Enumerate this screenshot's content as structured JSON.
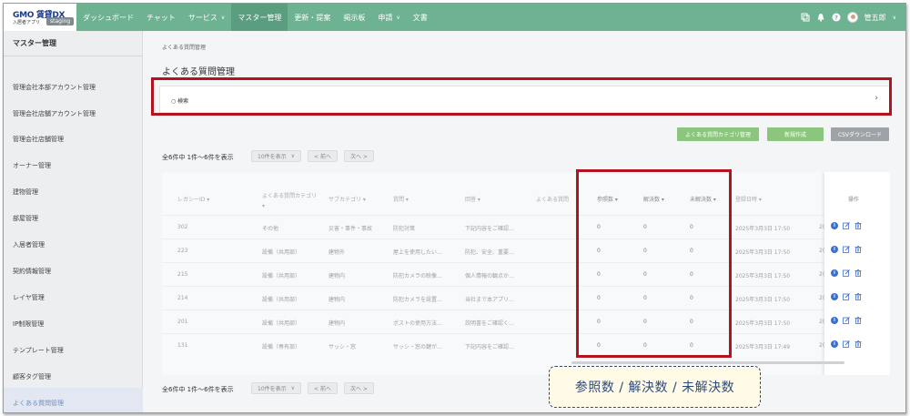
{
  "header": {
    "logo_main": "GMO 賃貸DX",
    "logo_sub": "入居者アプリ",
    "env_badge": "staging",
    "nav": [
      {
        "label": "ダッシュボード",
        "dropdown": false
      },
      {
        "label": "チャット",
        "dropdown": false
      },
      {
        "label": "サービス",
        "dropdown": true
      },
      {
        "label": "マスター管理",
        "dropdown": false,
        "active": true
      },
      {
        "label": "更新・提案",
        "dropdown": false
      },
      {
        "label": "掲示板",
        "dropdown": false
      },
      {
        "label": "申請",
        "dropdown": true
      },
      {
        "label": "文書",
        "dropdown": false
      }
    ],
    "user_name": "管五郎",
    "icons": [
      "window-icon",
      "bell-icon",
      "help-icon",
      "avatar"
    ]
  },
  "sidebar": {
    "title": "マスター管理",
    "items": [
      "管理会社本部アカウント管理",
      "管理会社店舗アカウント管理",
      "管理会社店舗管理",
      "オーナー管理",
      "建物管理",
      "部屋管理",
      "入居者管理",
      "契約情報管理",
      "レイヤ管理",
      "IP制限管理",
      "テンプレート管理",
      "顧客タグ管理",
      "よくある質問管理"
    ],
    "active_index": 12
  },
  "main": {
    "breadcrumb": "よくある質問管理",
    "title": "よくある質問管理",
    "search_label": "検索",
    "buttons": {
      "category": "よくある質問カテゴリ管理",
      "new": "新規作成",
      "csv": "CSVダウンロード"
    },
    "count_text": "全6件中 1件～6件を表示",
    "per_page": "10件を表示",
    "prev": "< 前へ",
    "next": "次へ >"
  },
  "table": {
    "columns": [
      "レガシーID",
      "よくある質問カテゴリ",
      "サブカテゴリ",
      "質問",
      "回答",
      "よくある質問",
      "参照数",
      "解決数",
      "未解決数",
      "登録日時",
      "操作"
    ],
    "rows": [
      {
        "id": "302",
        "cat": "その他",
        "sub": "災害・事件・事故",
        "q": "防犯対策",
        "a": "下記内容をご確認…",
        "ref": "0",
        "sol": "0",
        "unsol": "0",
        "date": "2025年3月3日 17:50",
        "extra": "2("
      },
      {
        "id": "223",
        "cat": "設備（共用部）",
        "sub": "建物外",
        "q": "屋上を使用したい…",
        "a": "防犯、安全、重要…",
        "ref": "0",
        "sol": "0",
        "unsol": "0",
        "date": "2025年3月3日 17:50",
        "extra": "2("
      },
      {
        "id": "215",
        "cat": "設備（共用部）",
        "sub": "建物内",
        "q": "防犯カメラの映像…",
        "a": "個人情報の観点か…",
        "ref": "0",
        "sol": "0",
        "unsol": "0",
        "date": "2025年3月3日 17:50",
        "extra": "2("
      },
      {
        "id": "214",
        "cat": "設備（共用部）",
        "sub": "建物内",
        "q": "防犯カメラを設置…",
        "a": "当社まで本アプリ…",
        "ref": "0",
        "sol": "0",
        "unsol": "0",
        "date": "2025年3月3日 17:50",
        "extra": "2("
      },
      {
        "id": "201",
        "cat": "設備（共用部）",
        "sub": "建物内",
        "q": "ポストの使用方法…",
        "a": "説明書をご確認く…",
        "ref": "0",
        "sol": "0",
        "unsol": "0",
        "date": "2025年3月3日 17:50",
        "extra": "2("
      },
      {
        "id": "131",
        "cat": "設備（専有部）",
        "sub": "サッシ・窓",
        "q": "サッシ・窓の鍵が…",
        "a": "下記内容をご確認…",
        "ref": "0",
        "sol": "0",
        "unsol": "0",
        "date": "2025年3月3日 17:49",
        "extra": "2("
      }
    ]
  },
  "callout": "参照数 / 解決数 / 未解決数",
  "colors": {
    "topbar": "#6db291",
    "highlight": "#b3121f",
    "callout_border": "#2f4a7a"
  }
}
